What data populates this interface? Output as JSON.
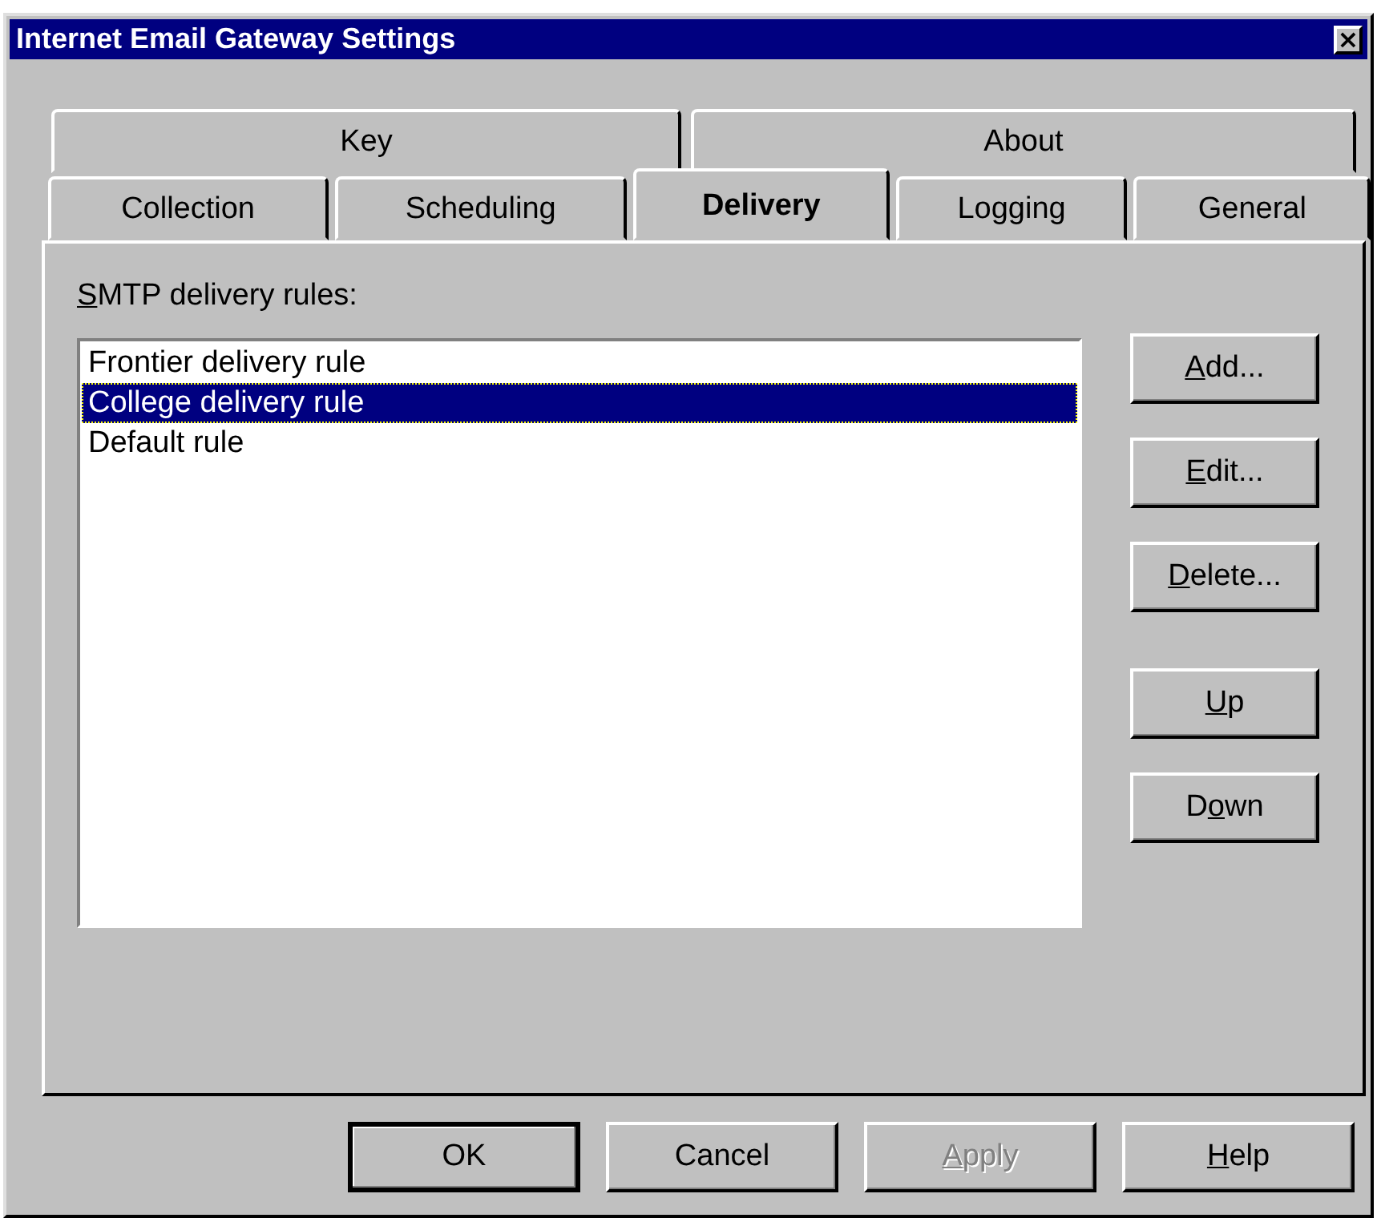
{
  "window": {
    "title": "Internet Email Gateway Settings",
    "close": "×"
  },
  "tab_rows": [
    {
      "tabs": [
        {
          "label": "Key",
          "selected": false
        },
        {
          "label": "About",
          "selected": false
        }
      ]
    },
    {
      "tabs": [
        {
          "label": "Collection",
          "selected": false
        },
        {
          "label": "Scheduling",
          "selected": false
        },
        {
          "label": "Delivery",
          "selected": true
        },
        {
          "label": "Logging",
          "selected": false
        },
        {
          "label": "General",
          "selected": false
        }
      ]
    }
  ],
  "rules_label": [
    {
      "text": "S",
      "underlined": true
    },
    {
      "text": "MTP delivery rules:",
      "underlined": false
    }
  ],
  "rules": [
    {
      "label": "Frontier delivery rule",
      "selected": false
    },
    {
      "label": "College delivery rule",
      "selected": true
    },
    {
      "label": "Default rule",
      "selected": false
    }
  ],
  "side_buttons": [
    {
      "label": [
        {
          "text": "A",
          "underlined": true
        },
        {
          "text": "dd...",
          "underlined": false
        }
      ]
    },
    {
      "label": [
        {
          "text": "E",
          "underlined": true
        },
        {
          "text": "dit...",
          "underlined": false
        }
      ]
    },
    {
      "label": [
        {
          "text": "D",
          "underlined": true
        },
        {
          "text": "elete...",
          "underlined": false
        }
      ]
    },
    {
      "label": [
        {
          "text": "U",
          "underlined": true
        },
        {
          "text": "p",
          "underlined": false
        }
      ]
    },
    {
      "label": [
        {
          "text": "D",
          "underlined": false
        },
        {
          "text": "o",
          "underlined": true
        },
        {
          "text": "wn",
          "underlined": false
        }
      ]
    }
  ],
  "dialog_buttons": [
    {
      "label": [
        {
          "text": "OK",
          "underlined": false
        }
      ],
      "default": true,
      "disabled": false
    },
    {
      "label": [
        {
          "text": "Cancel",
          "underlined": false
        }
      ],
      "default": false,
      "disabled": false
    },
    {
      "label": [
        {
          "text": "A",
          "underlined": true
        },
        {
          "text": "pply",
          "underlined": false
        }
      ],
      "default": false,
      "disabled": true
    },
    {
      "label": [
        {
          "text": "H",
          "underlined": true
        },
        {
          "text": "elp",
          "underlined": false
        }
      ],
      "default": false,
      "disabled": false
    }
  ]
}
